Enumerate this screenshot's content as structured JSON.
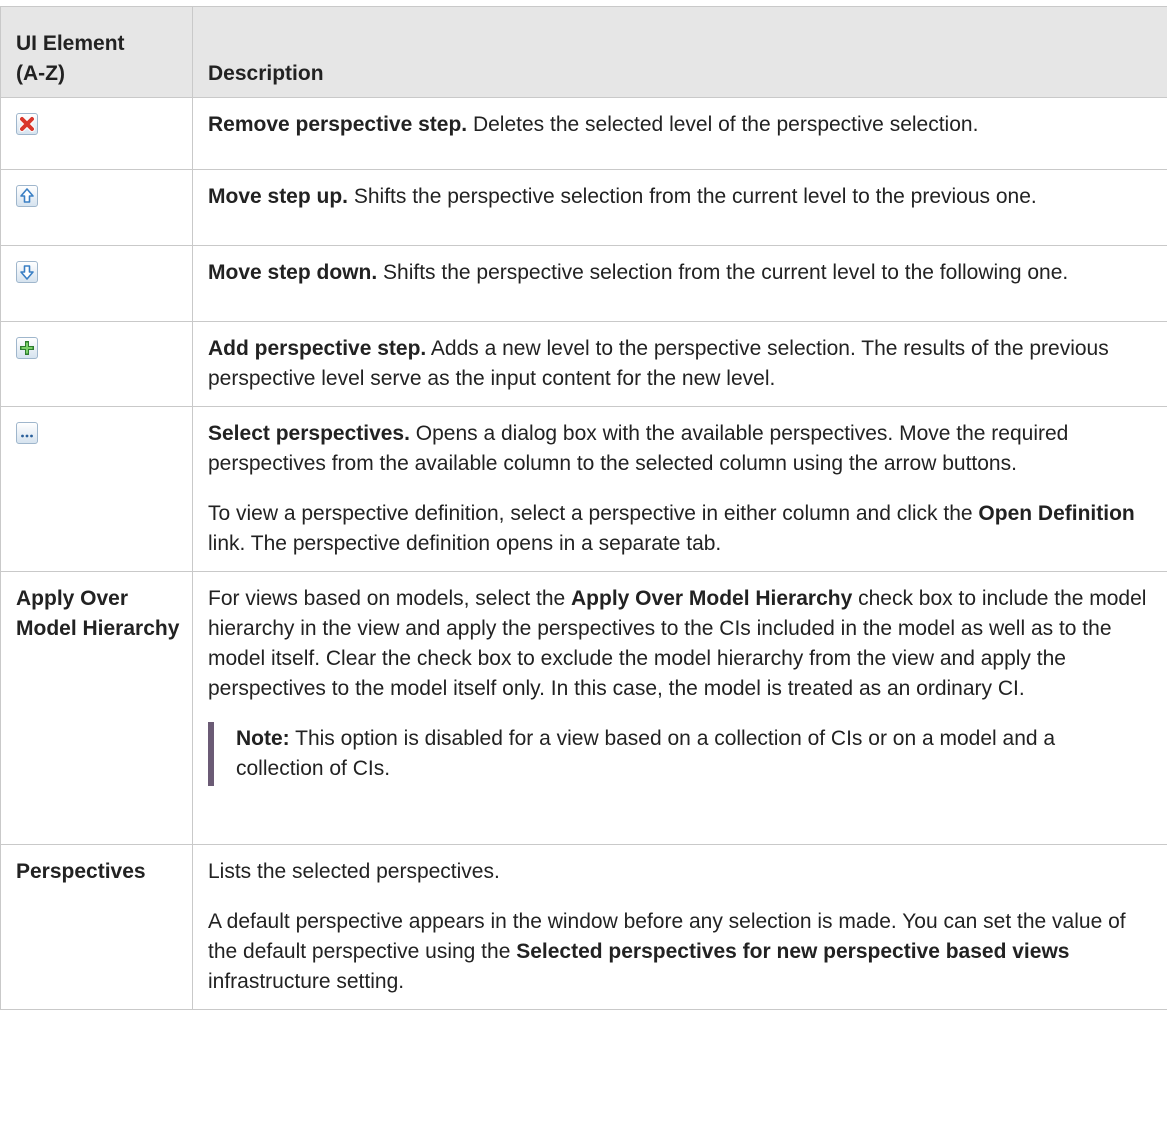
{
  "header": {
    "col1_line1": "UI Element",
    "col1_line2": "(A-Z)",
    "col2": "Description"
  },
  "rows": [
    {
      "icon": "remove-icon",
      "title": "Remove perspective step.",
      "text": " Deletes the selected level of the perspective selection."
    },
    {
      "icon": "move-up-icon",
      "title": "Move step up.",
      "text": " Shifts the perspective selection from the current level to the previous one."
    },
    {
      "icon": "move-down-icon",
      "title": "Move step down.",
      "text": " Shifts the perspective selection from the current level to the following one."
    },
    {
      "icon": "add-icon",
      "title": "Add perspective step.",
      "text": " Adds a new level to the perspective selection. The results of the previous perspective level serve as the input content for the new level."
    },
    {
      "icon": "ellipsis-icon",
      "title": "Select perspectives.",
      "text": " Opens a dialog box with the available perspectives. Move the required perspectives from the available column to the selected column using the arrow buttons.",
      "p2_a": "To view a perspective definition, select a perspective in either column and click the ",
      "p2_b": "Open Definition",
      "p2_c": " link. The perspective definition opens in a separate tab."
    },
    {
      "element": "Apply Over Model Hierarchy",
      "p1_a": "For views based on models, select the ",
      "p1_b": "Apply Over Model Hierarchy",
      "p1_c": " check box to include the model hierarchy in the view and apply the perspectives to the CIs included in the model as well as to the model itself. Clear the check box to exclude the model hierarchy from the view and apply the perspectives to the model itself only. In this case, the model is treated as an ordinary CI.",
      "note_label": "Note:",
      "note_text": "  This option is disabled for a view based on a collection of CIs or on a model and a collection of CIs."
    },
    {
      "element": "Perspectives",
      "p1": "Lists the selected perspectives.",
      "p2_a": "A default perspective appears in the window before any selection is made. You can set the value of the default perspective using the ",
      "p2_b": "Selected perspectives for new perspective based views",
      "p2_c": " infrastructure setting."
    }
  ]
}
